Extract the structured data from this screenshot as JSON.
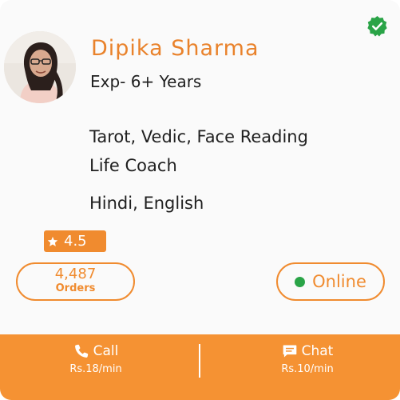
{
  "profile": {
    "name": "Dipika Sharma",
    "experience": "Exp- 6+ Years",
    "skills": "Tarot, Vedic, Face Reading",
    "role": "Life Coach",
    "languages": "Hindi, English"
  },
  "rating": {
    "value": "4.5"
  },
  "orders": {
    "count": "4,487",
    "label": "Orders"
  },
  "status": {
    "label": "Online"
  },
  "actions": {
    "call": {
      "label": "Call",
      "price": "Rs.18/min"
    },
    "chat": {
      "label": "Chat",
      "price": "Rs.10/min"
    }
  },
  "colors": {
    "accent": "#f08b2f",
    "bar": "#f59233",
    "verified": "#2aa447",
    "online_dot": "#2aa447"
  },
  "icons": {
    "verified": "verified-badge-icon",
    "star": "star-icon",
    "call": "phone-icon",
    "chat": "chat-bubble-icon"
  }
}
